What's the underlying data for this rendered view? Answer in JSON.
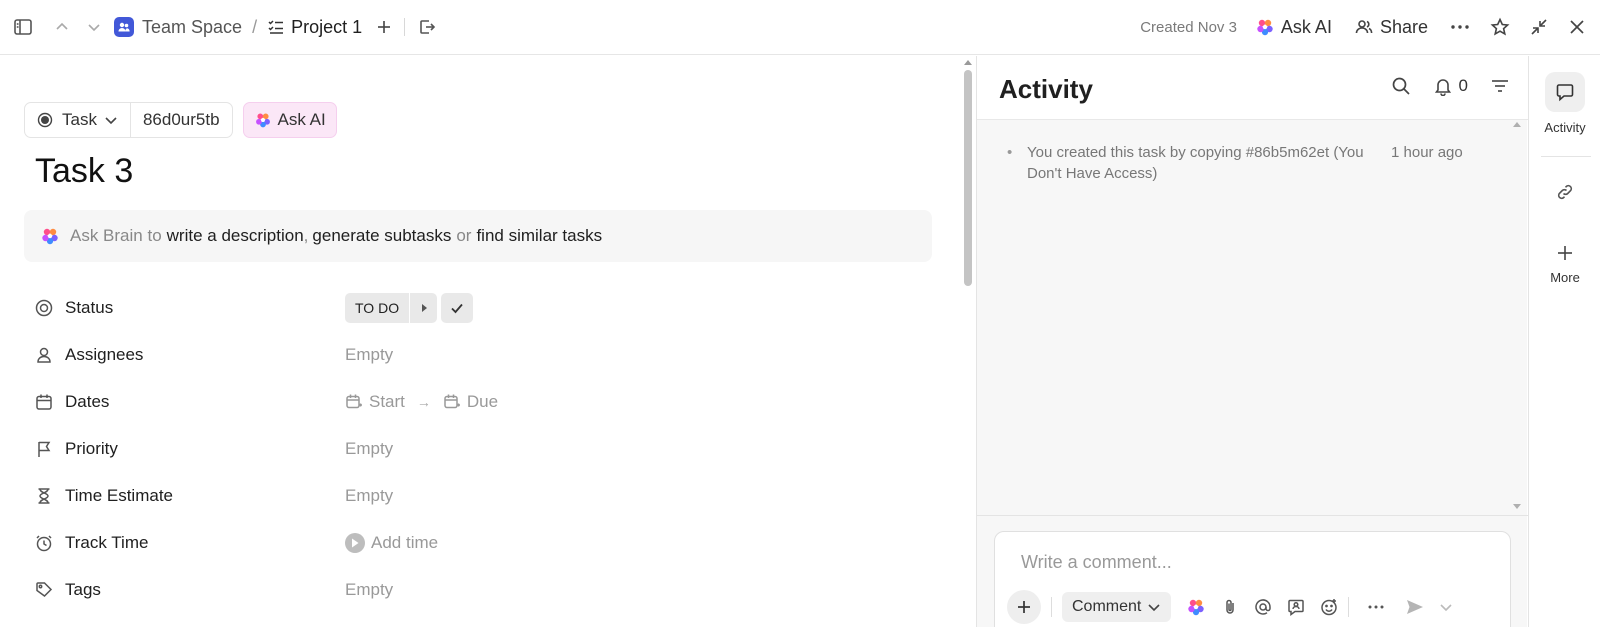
{
  "topbar": {
    "space": "Team Space",
    "separator": "/",
    "current": "Project 1",
    "created": "Created Nov 3",
    "ask_ai": "Ask AI",
    "share": "Share"
  },
  "task": {
    "type_label": "Task",
    "id": "86d0ur5tb",
    "ask_ai": "Ask AI",
    "title": "Task 3"
  },
  "brain": {
    "prefix": "Ask Brain to",
    "link1": "write a description",
    "comma": ",",
    "link2": "generate subtasks",
    "or": "or",
    "link3": "find similar tasks"
  },
  "properties": {
    "status": {
      "label": "Status",
      "value": "TO DO"
    },
    "assignees": {
      "label": "Assignees",
      "value": "Empty"
    },
    "dates": {
      "label": "Dates",
      "start": "Start",
      "arrow": "→",
      "due": "Due"
    },
    "priority": {
      "label": "Priority",
      "value": "Empty"
    },
    "time_estimate": {
      "label": "Time Estimate",
      "value": "Empty"
    },
    "track_time": {
      "label": "Track Time",
      "value": "Add time"
    },
    "tags": {
      "label": "Tags",
      "value": "Empty"
    }
  },
  "activity": {
    "title": "Activity",
    "notification_count": "0",
    "entries": [
      {
        "text": "You created this task by copying #86b5m62et (You Don't Have Access)",
        "time": "1 hour ago"
      }
    ],
    "comment_placeholder": "Write a comment...",
    "comment_type": "Comment"
  },
  "rail": {
    "activity_label": "Activity",
    "more_label": "More"
  },
  "colors": {
    "space_badge": "#4258d8",
    "ai_pill_bg": "#fbe7f7",
    "activity_bg": "#f7f7f7"
  }
}
